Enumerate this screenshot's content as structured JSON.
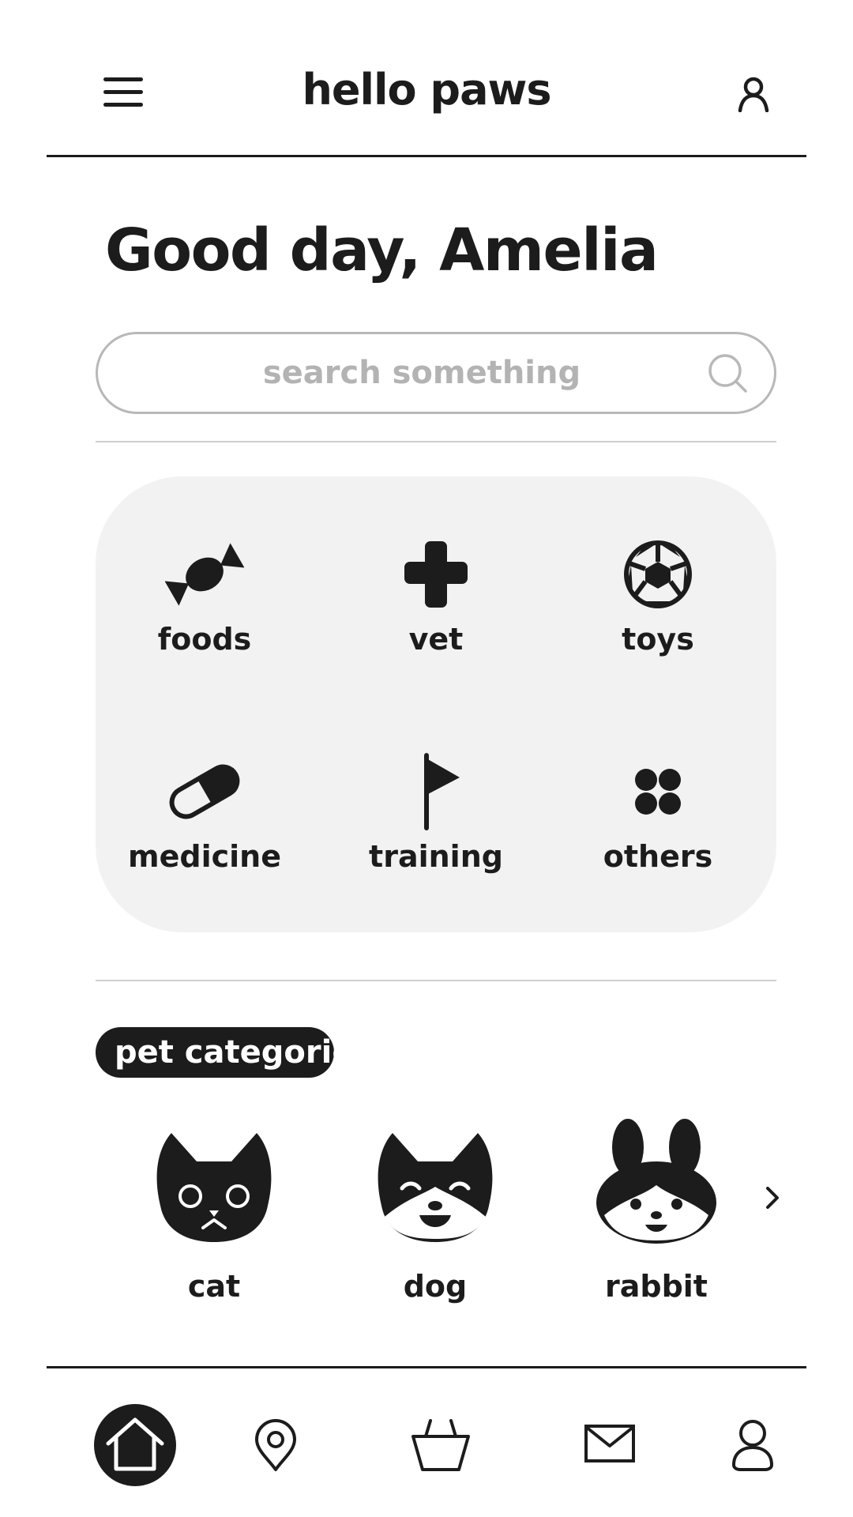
{
  "header": {
    "title": "hello paws",
    "menu_icon": "hamburger-menu-icon",
    "profile_icon": "user-icon"
  },
  "greeting": "Good day, Amelia",
  "search": {
    "placeholder": "search something",
    "value": "",
    "icon": "search-icon"
  },
  "categories": [
    {
      "label": "foods",
      "icon": "candy-icon"
    },
    {
      "label": "vet",
      "icon": "medical-cross-icon"
    },
    {
      "label": "toys",
      "icon": "soccer-ball-icon"
    },
    {
      "label": "medicine",
      "icon": "pill-capsule-icon"
    },
    {
      "label": "training",
      "icon": "flag-icon"
    },
    {
      "label": "others",
      "icon": "four-dots-icon"
    }
  ],
  "pet_section": {
    "title": "pet categories"
  },
  "pets": [
    {
      "label": "cat",
      "icon": "cat-face-icon"
    },
    {
      "label": "dog",
      "icon": "dog-face-icon"
    },
    {
      "label": "rabbit",
      "icon": "rabbit-face-icon"
    }
  ],
  "bottom_nav": [
    {
      "icon": "home-icon",
      "active": true
    },
    {
      "icon": "location-pin-icon",
      "active": false
    },
    {
      "icon": "shopping-basket-icon",
      "active": false
    },
    {
      "icon": "mail-icon",
      "active": false
    },
    {
      "icon": "user-icon",
      "active": false
    }
  ],
  "colors": {
    "primary": "#1c1c1c",
    "panel": "#f2f2f2",
    "placeholder": "#b3b3b3",
    "background": "#ffffff"
  }
}
